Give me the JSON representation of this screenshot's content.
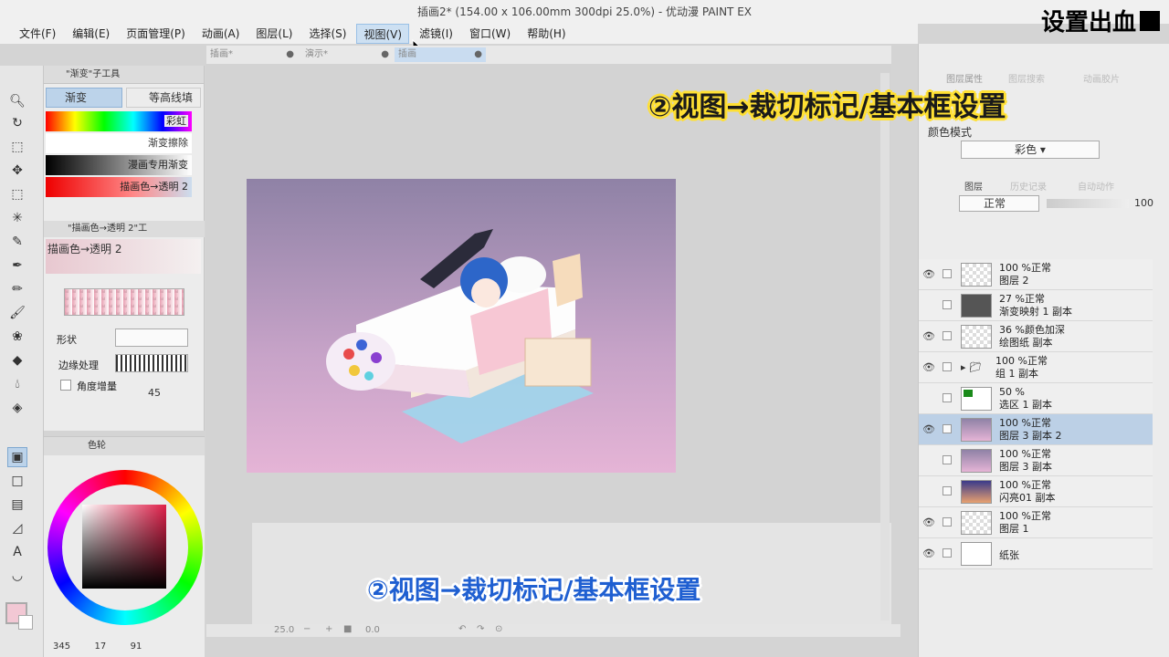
{
  "window": {
    "title": "插画2* (154.00 x 106.00mm 300dpi 25.0%) - 优动漫 PAINT EX"
  },
  "overlay": {
    "corner_text": "设置出血",
    "top_caption": "②视图→裁切标记/基本框设置",
    "bottom_caption": "②视图→裁切标记/基本框设置"
  },
  "menu": [
    "文件(F)",
    "编辑(E)",
    "页面管理(P)",
    "动画(A)",
    "图层(L)",
    "选择(S)",
    "视图(V)",
    "滤镜(I)",
    "窗口(W)",
    "帮助(H)"
  ],
  "menu_active": "视图(V)",
  "doc_tabs": [
    {
      "label": "插画*",
      "dot": "●"
    },
    {
      "label": "演示*",
      "dot": "●"
    },
    {
      "label": "插画",
      "dot": "●"
    }
  ],
  "subtool": {
    "header": "\"渐变\"子工具",
    "tab_active": "渐变",
    "tab_other": "等高线填",
    "gradients": [
      "彩虹",
      "渐变擦除",
      "漫画专用渐变",
      "描画色→透明 2"
    ],
    "detail_header": "\"描画色→透明 2\"工",
    "current_name": "描画色→透明 2",
    "shape_label": "形状",
    "edge_label": "边缘处理",
    "angle_label": "角度增量",
    "angle_value": "45"
  },
  "color_panel": {
    "header": "色轮",
    "hsv": [
      "345",
      "17",
      "91"
    ]
  },
  "status": {
    "zoom": "25.0",
    "angle": "0.0"
  },
  "right_panel": {
    "tabs_top": [
      "图层属性",
      "图层搜索",
      "动画胶片"
    ],
    "color_mode_label": "颜色模式",
    "color_mode_value": "彩色",
    "tabs_layer": [
      "图层",
      "历史记录",
      "自动动作"
    ],
    "blend_mode": "正常",
    "opacity": "100"
  },
  "layers": [
    {
      "line1": "100 %正常",
      "line2": "图层 2",
      "visible": true,
      "thumb": "checker"
    },
    {
      "line1": "27 %正常",
      "line2": "渐变映射 1 副本",
      "visible": false,
      "thumb": "gray"
    },
    {
      "line1": "36 %颜色加深",
      "line2": "绘图纸 副本",
      "visible": true,
      "thumb": "checker"
    },
    {
      "line1": "100 %正常",
      "line2": "组 1 副本",
      "visible": true,
      "thumb": "folder"
    },
    {
      "line1": "50 %",
      "line2": "选区 1 副本",
      "visible": false,
      "thumb": "green"
    },
    {
      "line1": "100 %正常",
      "line2": "图层 3 副本 2",
      "visible": true,
      "thumb": "gradient",
      "selected": true
    },
    {
      "line1": "100 %正常",
      "line2": "图层 3 副本",
      "visible": false,
      "thumb": "gradient"
    },
    {
      "line1": "100 %正常",
      "line2": "闪亮01 副本",
      "visible": false,
      "thumb": "sparkle"
    },
    {
      "line1": "100 %正常",
      "line2": "图层 1",
      "visible": true,
      "thumb": "checker"
    },
    {
      "line1": "",
      "line2": "纸张",
      "visible": true,
      "thumb": "white"
    }
  ]
}
